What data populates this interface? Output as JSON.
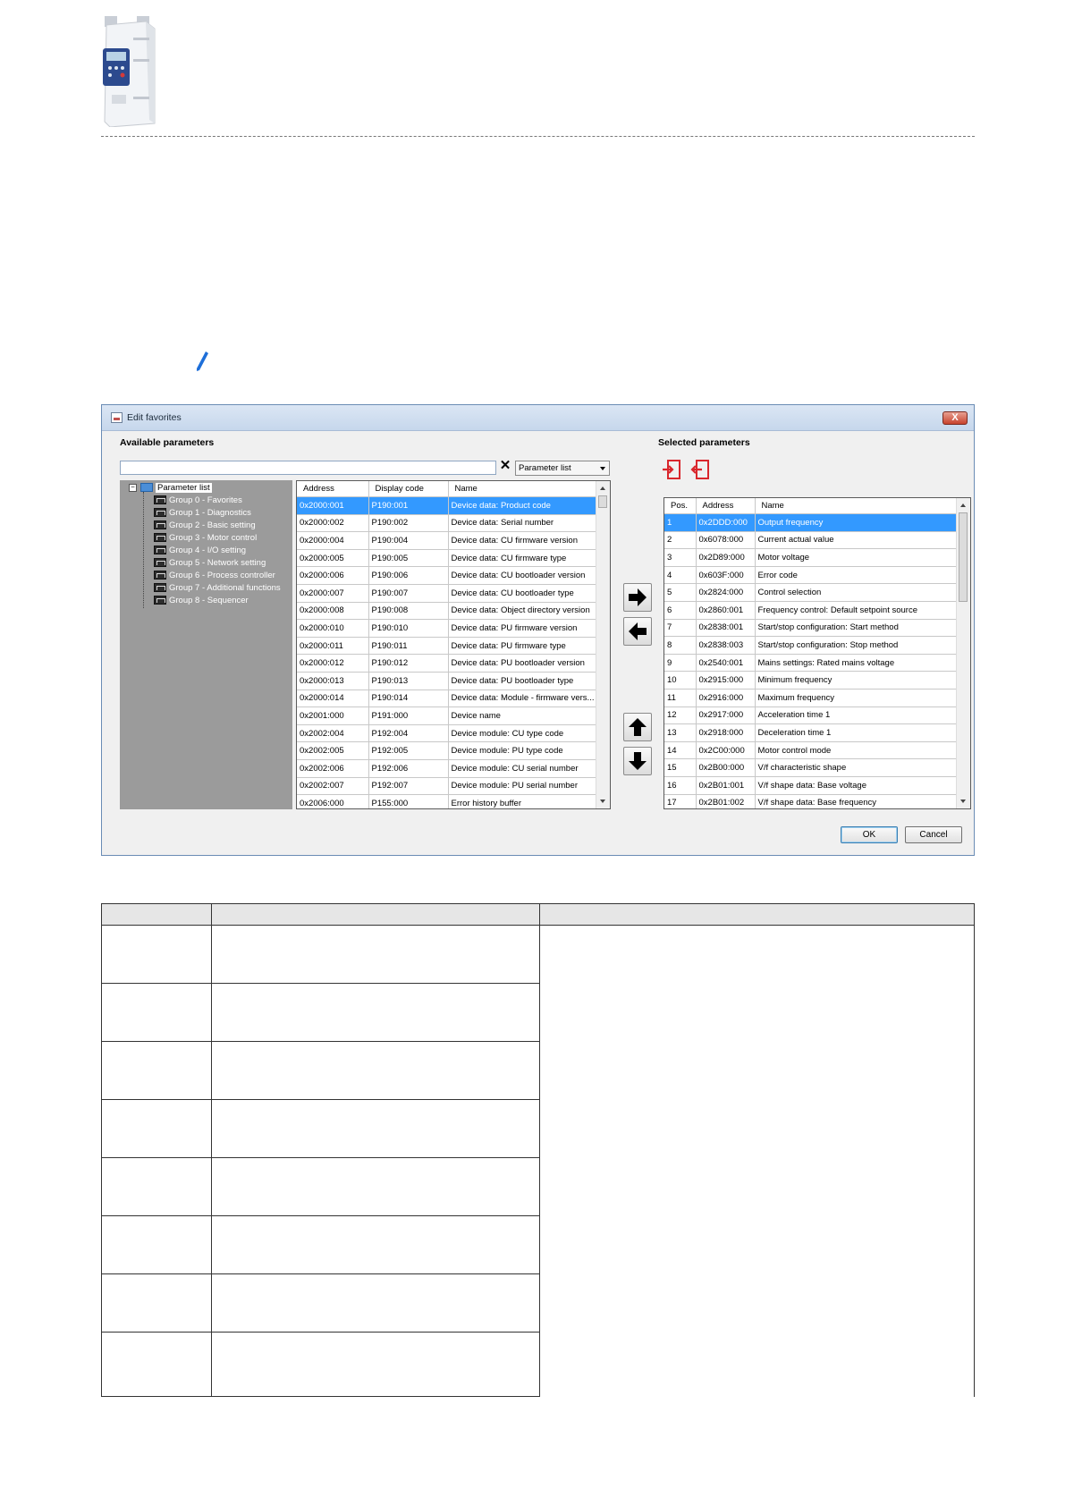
{
  "dialog": {
    "title": "Edit favorites",
    "close_label": "X",
    "available_label": "Available parameters",
    "selected_label": "Selected parameters",
    "search_value": "",
    "clear_icon": "x-icon",
    "dropdown_value": "Parameter list",
    "tree": {
      "root": "Parameter list",
      "groups": [
        "Group 0 - Favorites",
        "Group 1 - Diagnostics",
        "Group 2 - Basic setting",
        "Group 3 - Motor control",
        "Group 4 - I/O setting",
        "Group 5 - Network setting",
        "Group 6 - Process controller",
        "Group 7 - Additional functions",
        "Group 8 - Sequencer"
      ]
    },
    "available_table": {
      "columns": [
        "Address",
        "Display code",
        "Name"
      ],
      "rows": [
        [
          "0x2000:001",
          "P190:001",
          "Device data: Product code"
        ],
        [
          "0x2000:002",
          "P190:002",
          "Device data: Serial number"
        ],
        [
          "0x2000:004",
          "P190:004",
          "Device data: CU firmware version"
        ],
        [
          "0x2000:005",
          "P190:005",
          "Device data: CU firmware type"
        ],
        [
          "0x2000:006",
          "P190:006",
          "Device data: CU bootloader version"
        ],
        [
          "0x2000:007",
          "P190:007",
          "Device data: CU bootloader type"
        ],
        [
          "0x2000:008",
          "P190:008",
          "Device data: Object directory version"
        ],
        [
          "0x2000:010",
          "P190:010",
          "Device data: PU firmware version"
        ],
        [
          "0x2000:011",
          "P190:011",
          "Device data: PU firmware type"
        ],
        [
          "0x2000:012",
          "P190:012",
          "Device data: PU bootloader version"
        ],
        [
          "0x2000:013",
          "P190:013",
          "Device data: PU bootloader type"
        ],
        [
          "0x2000:014",
          "P190:014",
          "Device data: Module - firmware vers..."
        ],
        [
          "0x2001:000",
          "P191:000",
          "Device name"
        ],
        [
          "0x2002:004",
          "P192:004",
          "Device module: CU type code"
        ],
        [
          "0x2002:005",
          "P192:005",
          "Device module: PU type code"
        ],
        [
          "0x2002:006",
          "P192:006",
          "Device module: CU serial number"
        ],
        [
          "0x2002:007",
          "P192:007",
          "Device module: PU serial number"
        ],
        [
          "0x2006:000",
          "P155:000",
          "Error history buffer"
        ]
      ]
    },
    "selected_table": {
      "columns": [
        "Pos.",
        "Address",
        "Name"
      ],
      "rows": [
        [
          "1",
          "0x2DDD:000",
          "Output frequency"
        ],
        [
          "2",
          "0x6078:000",
          "Current actual value"
        ],
        [
          "3",
          "0x2D89:000",
          "Motor voltage"
        ],
        [
          "4",
          "0x603F:000",
          "Error code"
        ],
        [
          "5",
          "0x2824:000",
          "Control selection"
        ],
        [
          "6",
          "0x2860:001",
          "Frequency control: Default setpoint source"
        ],
        [
          "7",
          "0x2838:001",
          "Start/stop configuration: Start method"
        ],
        [
          "8",
          "0x2838:003",
          "Start/stop configuration: Stop method"
        ],
        [
          "9",
          "0x2540:001",
          "Mains settings: Rated mains voltage"
        ],
        [
          "10",
          "0x2915:000",
          "Minimum frequency"
        ],
        [
          "11",
          "0x2916:000",
          "Maximum frequency"
        ],
        [
          "12",
          "0x2917:000",
          "Acceleration time 1"
        ],
        [
          "13",
          "0x2918:000",
          "Deceleration time 1"
        ],
        [
          "14",
          "0x2C00:000",
          "Motor control mode"
        ],
        [
          "15",
          "0x2B00:000",
          "V/f characteristic shape"
        ],
        [
          "16",
          "0x2B01:001",
          "V/f shape data: Base voltage"
        ],
        [
          "17",
          "0x2B01:002",
          "V/f shape data: Base frequency"
        ]
      ]
    },
    "ok_label": "OK",
    "cancel_label": "Cancel"
  },
  "colors": {
    "selection": "#3399ff",
    "tree_background": "#9b9b9b",
    "dialog_background": "#f0f0f0",
    "import_export_icons": "#d9262c",
    "pencil": "#1e6fd9"
  }
}
